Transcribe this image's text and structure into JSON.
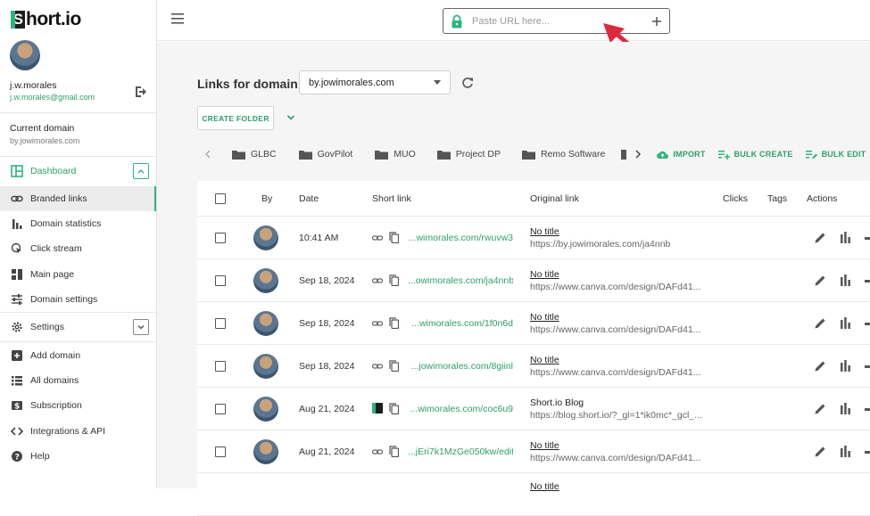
{
  "app": {
    "logo_text": "hort.io",
    "logo_letter": "S"
  },
  "user": {
    "name": "j.w.morales",
    "email": "j.w.morales@gmail.com"
  },
  "domain": {
    "label": "Current domain",
    "value": "by.jowimorales.com"
  },
  "sidebar": {
    "items": [
      {
        "label": "Dashboard",
        "icon": "dashboard-icon"
      },
      {
        "label": "Branded links",
        "icon": "link-icon"
      },
      {
        "label": "Domain statistics",
        "icon": "bar-chart-icon"
      },
      {
        "label": "Click stream",
        "icon": "click-icon"
      },
      {
        "label": "Main page",
        "icon": "main-page-icon"
      },
      {
        "label": "Domain settings",
        "icon": "sliders-icon"
      },
      {
        "label": "Settings",
        "icon": "gear-icon"
      },
      {
        "label": "Add domain",
        "icon": "plus-box-icon"
      },
      {
        "label": "All domains",
        "icon": "list-icon"
      },
      {
        "label": "Subscription",
        "icon": "dollar-icon"
      },
      {
        "label": "Integrations & API",
        "icon": "code-icon"
      },
      {
        "label": "Help",
        "icon": "help-icon"
      }
    ]
  },
  "topbar": {
    "url_placeholder": "Paste URL here..."
  },
  "main": {
    "title": "Links for domain",
    "selected_domain": "by.jowimorales.com",
    "create_folder": "CREATE FOLDER",
    "folders": [
      "GLBC",
      "GovPilot",
      "MUO",
      "Project DP",
      "Remo Software"
    ],
    "actions": {
      "import": "IMPORT",
      "bulk_create": "BULK CREATE",
      "bulk_edit": "BULK EDIT"
    }
  },
  "table": {
    "headers": {
      "by": "By",
      "date": "Date",
      "short": "Short link",
      "original": "Original link",
      "clicks": "Clicks",
      "tags": "Tags",
      "actions": "Actions"
    },
    "rows": [
      {
        "date": "10:41 AM",
        "short": "...wimorales.com/rwuvw3",
        "title": "No title",
        "url": "https://by.jowimorales.com/ja4nnb"
      },
      {
        "date": "Sep 18, 2024",
        "short": "...owimorales.com/ja4nnb",
        "title": "No title",
        "url": "https://www.canva.com/design/DAFd41..."
      },
      {
        "date": "Sep 18, 2024",
        "short": "...wimorales.com/1f0n6d",
        "title": "No title",
        "url": "https://www.canva.com/design/DAFd41..."
      },
      {
        "date": "Sep 18, 2024",
        "short": "...jowimorales.com/8giinl",
        "title": "No title",
        "url": "https://www.canva.com/design/DAFd41..."
      },
      {
        "date": "Aug 21, 2024",
        "short": "...wimorales.com/coc6u9",
        "title": "Short.io Blog",
        "url": "https://blog.short.io/?_gl=1*ik0mc*_gcl_..."
      },
      {
        "date": "Aug 21, 2024",
        "short": "...jEri7k1MzGe050kw/edit",
        "title": "No title",
        "url": "https://www.canva.com/design/DAFd41..."
      },
      {
        "title": "No title"
      }
    ]
  },
  "colors": {
    "accent": "#2fb37e",
    "link": "#2e9e6e",
    "arrow": "#e0283c"
  }
}
